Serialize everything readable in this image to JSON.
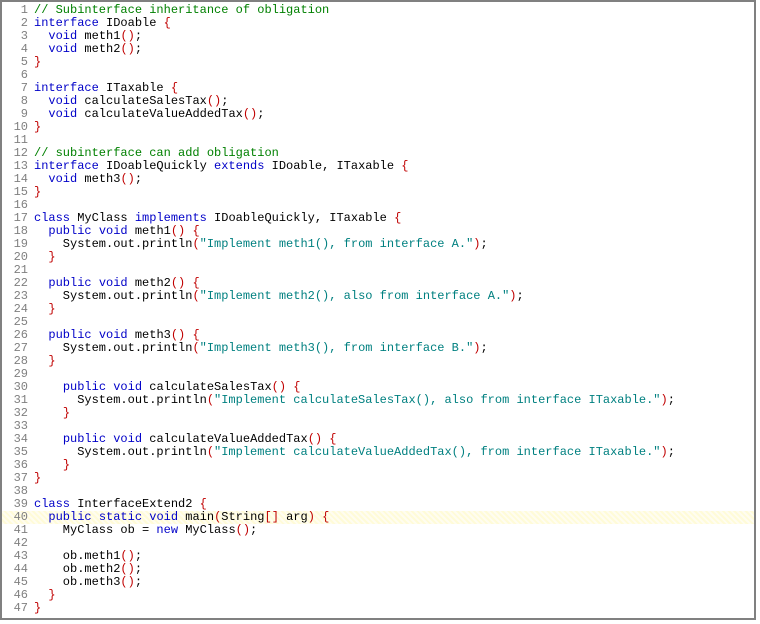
{
  "lines": [
    {
      "n": 1,
      "tokens": [
        [
          "cmt",
          "// Subinterface inheritance of obligation"
        ]
      ]
    },
    {
      "n": 2,
      "tokens": [
        [
          "kw",
          "interface"
        ],
        [
          "txt",
          " IDoable "
        ],
        [
          "br",
          "{"
        ]
      ]
    },
    {
      "n": 3,
      "tokens": [
        [
          "txt",
          "  "
        ],
        [
          "kw",
          "void"
        ],
        [
          "txt",
          " meth1"
        ],
        [
          "br",
          "()"
        ],
        [
          "txt",
          ";"
        ]
      ]
    },
    {
      "n": 4,
      "tokens": [
        [
          "txt",
          "  "
        ],
        [
          "kw",
          "void"
        ],
        [
          "txt",
          " meth2"
        ],
        [
          "br",
          "()"
        ],
        [
          "txt",
          ";"
        ]
      ]
    },
    {
      "n": 5,
      "tokens": [
        [
          "br",
          "}"
        ]
      ]
    },
    {
      "n": 6,
      "tokens": [
        [
          "txt",
          ""
        ]
      ]
    },
    {
      "n": 7,
      "tokens": [
        [
          "kw",
          "interface"
        ],
        [
          "txt",
          " ITaxable "
        ],
        [
          "br",
          "{"
        ]
      ]
    },
    {
      "n": 8,
      "tokens": [
        [
          "txt",
          "  "
        ],
        [
          "kw",
          "void"
        ],
        [
          "txt",
          " calculateSalesTax"
        ],
        [
          "br",
          "()"
        ],
        [
          "txt",
          ";"
        ]
      ]
    },
    {
      "n": 9,
      "tokens": [
        [
          "txt",
          "  "
        ],
        [
          "kw",
          "void"
        ],
        [
          "txt",
          " calculateValueAddedTax"
        ],
        [
          "br",
          "()"
        ],
        [
          "txt",
          ";"
        ]
      ]
    },
    {
      "n": 10,
      "tokens": [
        [
          "br",
          "}"
        ]
      ]
    },
    {
      "n": 11,
      "tokens": [
        [
          "txt",
          ""
        ]
      ]
    },
    {
      "n": 12,
      "tokens": [
        [
          "cmt",
          "// subinterface can add obligation"
        ]
      ]
    },
    {
      "n": 13,
      "tokens": [
        [
          "kw",
          "interface"
        ],
        [
          "txt",
          " IDoableQuickly "
        ],
        [
          "kw",
          "extends"
        ],
        [
          "txt",
          " IDoable, ITaxable "
        ],
        [
          "br",
          "{"
        ]
      ]
    },
    {
      "n": 14,
      "tokens": [
        [
          "txt",
          "  "
        ],
        [
          "kw",
          "void"
        ],
        [
          "txt",
          " meth3"
        ],
        [
          "br",
          "()"
        ],
        [
          "txt",
          ";"
        ]
      ]
    },
    {
      "n": 15,
      "tokens": [
        [
          "br",
          "}"
        ]
      ]
    },
    {
      "n": 16,
      "tokens": [
        [
          "txt",
          ""
        ]
      ]
    },
    {
      "n": 17,
      "tokens": [
        [
          "kw",
          "class"
        ],
        [
          "txt",
          " MyClass "
        ],
        [
          "kw",
          "implements"
        ],
        [
          "txt",
          " IDoableQuickly, ITaxable "
        ],
        [
          "br",
          "{"
        ]
      ]
    },
    {
      "n": 18,
      "tokens": [
        [
          "txt",
          "  "
        ],
        [
          "kw",
          "public"
        ],
        [
          "txt",
          " "
        ],
        [
          "kw",
          "void"
        ],
        [
          "txt",
          " meth1"
        ],
        [
          "br",
          "()"
        ],
        [
          "txt",
          " "
        ],
        [
          "br",
          "{"
        ]
      ]
    },
    {
      "n": 19,
      "tokens": [
        [
          "txt",
          "    System.out.println"
        ],
        [
          "br",
          "("
        ],
        [
          "str",
          "\"Implement meth1(), from interface A.\""
        ],
        [
          "br",
          ")"
        ],
        [
          "txt",
          ";"
        ]
      ]
    },
    {
      "n": 20,
      "tokens": [
        [
          "txt",
          "  "
        ],
        [
          "br",
          "}"
        ]
      ]
    },
    {
      "n": 21,
      "tokens": [
        [
          "txt",
          ""
        ]
      ]
    },
    {
      "n": 22,
      "tokens": [
        [
          "txt",
          "  "
        ],
        [
          "kw",
          "public"
        ],
        [
          "txt",
          " "
        ],
        [
          "kw",
          "void"
        ],
        [
          "txt",
          " meth2"
        ],
        [
          "br",
          "()"
        ],
        [
          "txt",
          " "
        ],
        [
          "br",
          "{"
        ]
      ]
    },
    {
      "n": 23,
      "tokens": [
        [
          "txt",
          "    System.out.println"
        ],
        [
          "br",
          "("
        ],
        [
          "str",
          "\"Implement meth2(), also from interface A.\""
        ],
        [
          "br",
          ")"
        ],
        [
          "txt",
          ";"
        ]
      ]
    },
    {
      "n": 24,
      "tokens": [
        [
          "txt",
          "  "
        ],
        [
          "br",
          "}"
        ]
      ]
    },
    {
      "n": 25,
      "tokens": [
        [
          "txt",
          ""
        ]
      ]
    },
    {
      "n": 26,
      "tokens": [
        [
          "txt",
          "  "
        ],
        [
          "kw",
          "public"
        ],
        [
          "txt",
          " "
        ],
        [
          "kw",
          "void"
        ],
        [
          "txt",
          " meth3"
        ],
        [
          "br",
          "()"
        ],
        [
          "txt",
          " "
        ],
        [
          "br",
          "{"
        ]
      ]
    },
    {
      "n": 27,
      "tokens": [
        [
          "txt",
          "    System.out.println"
        ],
        [
          "br",
          "("
        ],
        [
          "str",
          "\"Implement meth3(), from interface B.\""
        ],
        [
          "br",
          ")"
        ],
        [
          "txt",
          ";"
        ]
      ]
    },
    {
      "n": 28,
      "tokens": [
        [
          "txt",
          "  "
        ],
        [
          "br",
          "}"
        ]
      ]
    },
    {
      "n": 29,
      "tokens": [
        [
          "txt",
          ""
        ]
      ]
    },
    {
      "n": 30,
      "tokens": [
        [
          "txt",
          "    "
        ],
        [
          "kw",
          "public"
        ],
        [
          "txt",
          " "
        ],
        [
          "kw",
          "void"
        ],
        [
          "txt",
          " calculateSalesTax"
        ],
        [
          "br",
          "()"
        ],
        [
          "txt",
          " "
        ],
        [
          "br",
          "{"
        ]
      ]
    },
    {
      "n": 31,
      "tokens": [
        [
          "txt",
          "      System.out.println"
        ],
        [
          "br",
          "("
        ],
        [
          "str",
          "\"Implement calculateSalesTax(), also from interface ITaxable.\""
        ],
        [
          "br",
          ")"
        ],
        [
          "txt",
          ";"
        ]
      ]
    },
    {
      "n": 32,
      "tokens": [
        [
          "txt",
          "    "
        ],
        [
          "br",
          "}"
        ]
      ]
    },
    {
      "n": 33,
      "tokens": [
        [
          "txt",
          ""
        ]
      ]
    },
    {
      "n": 34,
      "tokens": [
        [
          "txt",
          "    "
        ],
        [
          "kw",
          "public"
        ],
        [
          "txt",
          " "
        ],
        [
          "kw",
          "void"
        ],
        [
          "txt",
          " calculateValueAddedTax"
        ],
        [
          "br",
          "()"
        ],
        [
          "txt",
          " "
        ],
        [
          "br",
          "{"
        ]
      ]
    },
    {
      "n": 35,
      "tokens": [
        [
          "txt",
          "      System.out.println"
        ],
        [
          "br",
          "("
        ],
        [
          "str",
          "\"Implement calculateValueAddedTax(), from interface ITaxable.\""
        ],
        [
          "br",
          ")"
        ],
        [
          "txt",
          ";"
        ]
      ]
    },
    {
      "n": 36,
      "tokens": [
        [
          "txt",
          "    "
        ],
        [
          "br",
          "}"
        ]
      ]
    },
    {
      "n": 37,
      "tokens": [
        [
          "br",
          "}"
        ]
      ]
    },
    {
      "n": 38,
      "tokens": [
        [
          "txt",
          ""
        ]
      ]
    },
    {
      "n": 39,
      "tokens": [
        [
          "kw",
          "class"
        ],
        [
          "txt",
          " InterfaceExtend2 "
        ],
        [
          "br",
          "{"
        ]
      ]
    },
    {
      "n": 40,
      "hl": true,
      "tokens": [
        [
          "txt",
          "  "
        ],
        [
          "kw",
          "public"
        ],
        [
          "txt",
          " "
        ],
        [
          "kw",
          "static"
        ],
        [
          "txt",
          " "
        ],
        [
          "kw",
          "void"
        ],
        [
          "txt",
          " main"
        ],
        [
          "br",
          "("
        ],
        [
          "txt",
          "String"
        ],
        [
          "br",
          "[]"
        ],
        [
          "txt",
          " arg"
        ],
        [
          "br",
          ")"
        ],
        [
          "txt",
          " "
        ],
        [
          "br",
          "{"
        ]
      ]
    },
    {
      "n": 41,
      "tokens": [
        [
          "txt",
          "    MyClass ob = "
        ],
        [
          "kw",
          "new"
        ],
        [
          "txt",
          " MyClass"
        ],
        [
          "br",
          "()"
        ],
        [
          "txt",
          ";"
        ]
      ]
    },
    {
      "n": 42,
      "tokens": [
        [
          "txt",
          ""
        ]
      ]
    },
    {
      "n": 43,
      "tokens": [
        [
          "txt",
          "    ob.meth1"
        ],
        [
          "br",
          "()"
        ],
        [
          "txt",
          ";"
        ]
      ]
    },
    {
      "n": 44,
      "tokens": [
        [
          "txt",
          "    ob.meth2"
        ],
        [
          "br",
          "()"
        ],
        [
          "txt",
          ";"
        ]
      ]
    },
    {
      "n": 45,
      "tokens": [
        [
          "txt",
          "    ob.meth3"
        ],
        [
          "br",
          "()"
        ],
        [
          "txt",
          ";"
        ]
      ]
    },
    {
      "n": 46,
      "tokens": [
        [
          "txt",
          "  "
        ],
        [
          "br",
          "}"
        ]
      ]
    },
    {
      "n": 47,
      "tokens": [
        [
          "br",
          "}"
        ]
      ]
    }
  ]
}
